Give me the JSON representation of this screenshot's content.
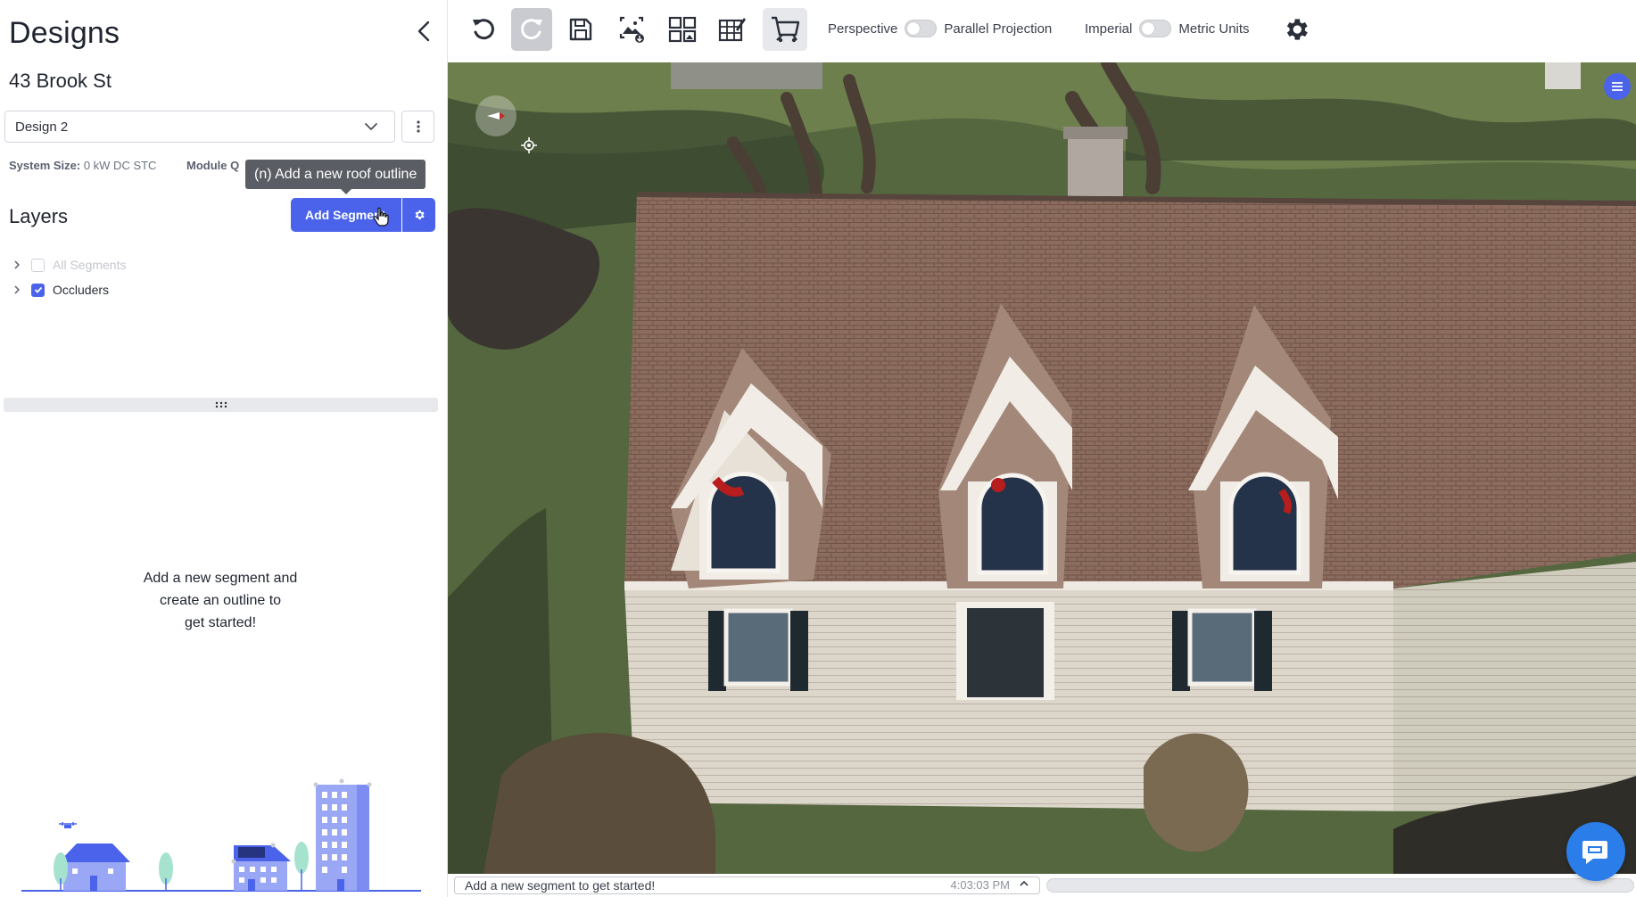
{
  "sidebar": {
    "title": "Designs",
    "address": "43 Brook St",
    "design_select": {
      "value": "Design 2"
    },
    "system_size_label": "System Size:",
    "system_size_value": "0 kW DC STC",
    "module_label": "Module Q",
    "tooltip": "(n) Add a new roof outline",
    "layers_title": "Layers",
    "add_segment_label": "Add Segment",
    "layers": [
      {
        "label": "All Segments",
        "checked": false,
        "enabled": false
      },
      {
        "label": "Occluders",
        "checked": true,
        "enabled": true
      }
    ],
    "empty_message_1": "Add a new segment and",
    "empty_message_2": "create an outline to",
    "empty_message_3": "get started!"
  },
  "toolbar": {
    "perspective_label": "Perspective",
    "parallel_label": "Parallel Projection",
    "imperial_label": "Imperial",
    "metric_label": "Metric Units"
  },
  "status": {
    "message": "Add a new segment to get started!",
    "time": "4:03:03 PM"
  },
  "colors": {
    "accent": "#4a63ea",
    "chat": "#2b7de9",
    "roof": "#8a6a5c"
  },
  "icons": [
    "undo-icon",
    "redo-icon",
    "save-icon",
    "image-export-icon",
    "grid-layout-icon",
    "table-edit-icon",
    "cart-icon",
    "gear-icon",
    "chevron-left-icon",
    "chevron-down-icon",
    "kebab-icon",
    "compass-icon",
    "locate-icon",
    "menu-icon",
    "chat-icon"
  ]
}
